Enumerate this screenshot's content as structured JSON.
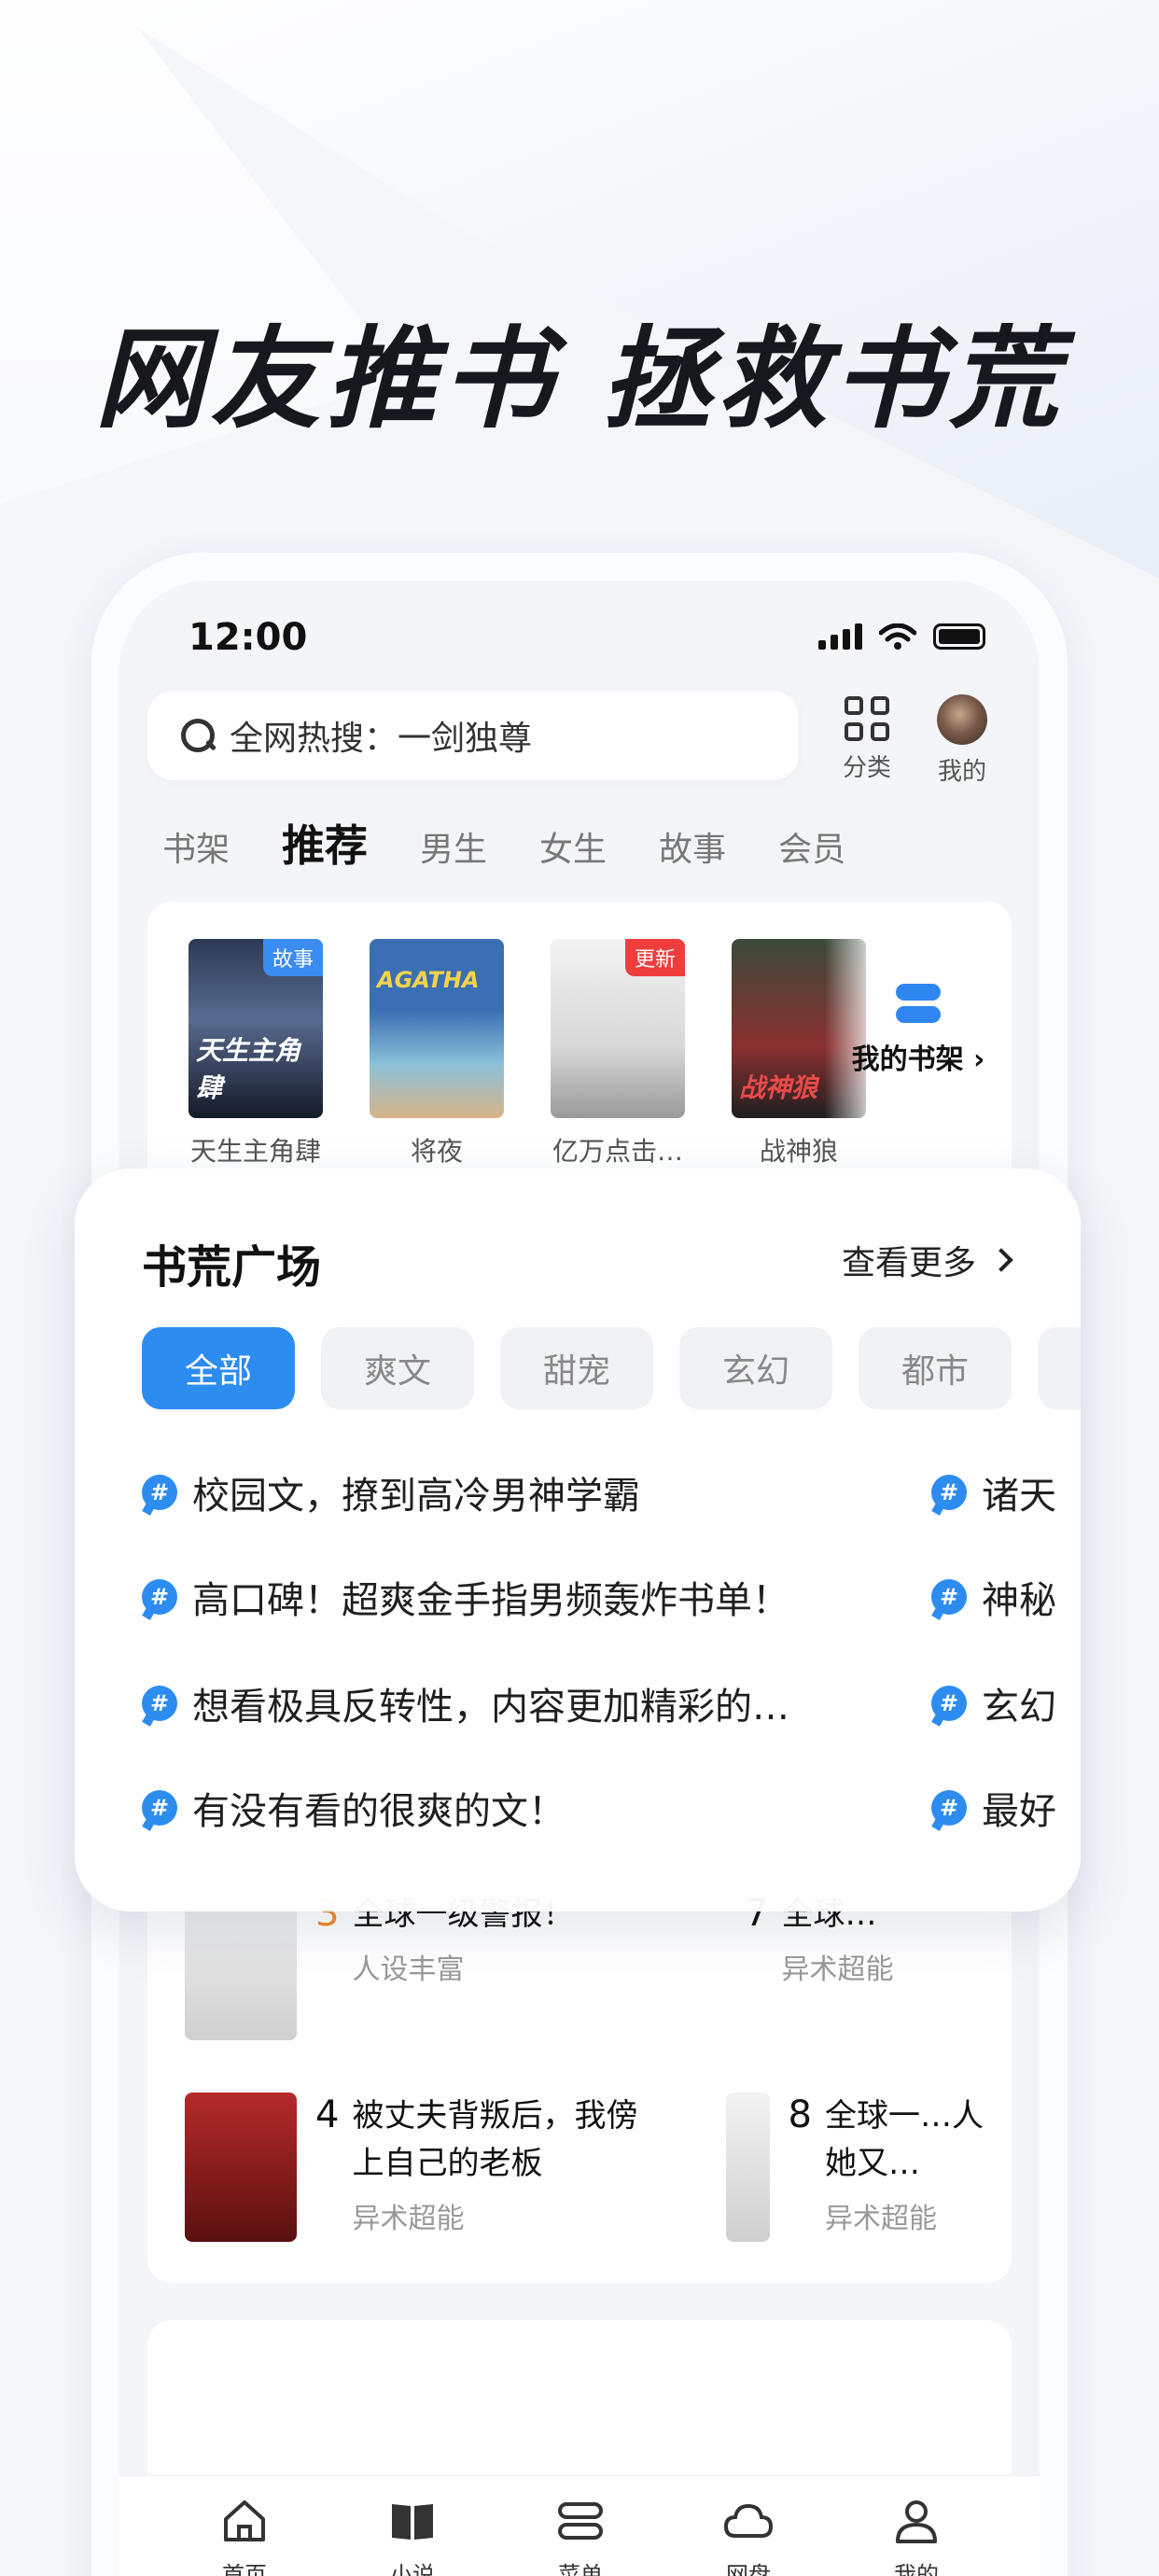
{
  "headline": "网友推书 拯救书荒",
  "status": {
    "time": "12:00"
  },
  "search": {
    "text": "全网热搜：一剑独尊"
  },
  "top_actions": {
    "category": "分类",
    "mine": "我的"
  },
  "tabs": [
    "书架",
    "推荐",
    "男生",
    "女生",
    "故事",
    "会员"
  ],
  "books": [
    {
      "title": "天生主角肆",
      "badge": "故事",
      "cover_text": "天生主角肆"
    },
    {
      "title": "将夜",
      "badge": "",
      "cover_text": "AGATHA"
    },
    {
      "title": "亿万点击…",
      "badge": "更新",
      "cover_text": ""
    },
    {
      "title": "战神狼",
      "badge": "",
      "cover_text": "战神狼"
    }
  ],
  "shelf_button": "我的书架",
  "list": [
    {
      "rank": "4",
      "title": "被丈夫背叛后，我傍上自己的老板",
      "tag": "异术超能"
    },
    {
      "rank": "8",
      "title": "全球一…人她又…",
      "tag": "异术超能"
    },
    {
      "rank": "3",
      "title": "全球一级警报！",
      "tag": "人设丰富"
    },
    {
      "rank": "7",
      "title": "全球…",
      "tag": "异术超能"
    }
  ],
  "modal": {
    "title": "书荒广场",
    "more": "查看更多",
    "chips": [
      "全部",
      "爽文",
      "甜宠",
      "玄幻",
      "都市"
    ],
    "topics_left": [
      "校园文，撩到高冷男神学霸",
      "高口碑！超爽金手指男频轰炸书单！",
      "想看极具反转性，内容更加精彩的…",
      "有没有看的很爽的文！"
    ],
    "topics_right": [
      "诸天",
      "神秘",
      "玄幻",
      "最好"
    ]
  },
  "nav": [
    "首页",
    "小说",
    "菜单",
    "网盘",
    "我的"
  ],
  "colors": {
    "accent": "#2d8cf0",
    "text": "#1f2329"
  }
}
